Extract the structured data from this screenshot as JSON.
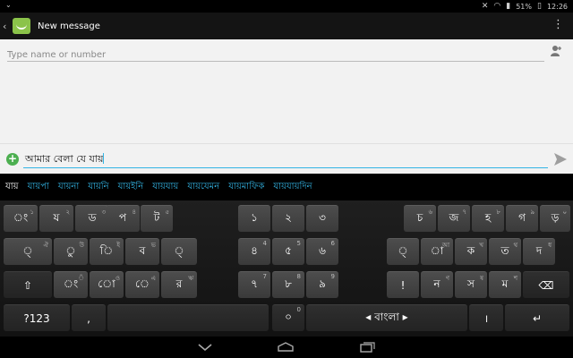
{
  "status": {
    "battery": "51%",
    "time": "12:26"
  },
  "action_bar": {
    "title": "New message"
  },
  "recipient": {
    "placeholder": "Type name or number"
  },
  "message": {
    "text": "আমার বেলা যে যায়"
  },
  "suggestions": [
    "যায়",
    "যায়পা",
    "যায়না",
    "যায়নি",
    "যায়ইনি",
    "যায়যায়",
    "যায়যেমন",
    "যায়মাফিক",
    "যায়যায়দিন"
  ],
  "keyboard": {
    "row1_left": [
      {
        "main": "ং",
        "hint": "১"
      },
      {
        "main": "য",
        "hint": "২"
      },
      {
        "main": "ড",
        "hint": "৩"
      },
      {
        "main": "প",
        "hint": "৪"
      },
      {
        "main": "ট",
        "hint": "৫"
      }
    ],
    "row1_mid": [
      "১",
      "২",
      "৩"
    ],
    "row1_right": [
      {
        "main": "চ",
        "hint": "৬"
      },
      {
        "main": "জ",
        "hint": "৭"
      },
      {
        "main": "হ",
        "hint": "৮"
      },
      {
        "main": "গ",
        "hint": "৯"
      },
      {
        "main": "ড়",
        "hint": "০"
      }
    ],
    "row2_left": [
      {
        "main": "্",
        "hint": "ঐ"
      },
      {
        "main": "ু",
        "hint": "উ"
      },
      {
        "main": "ি",
        "hint": "ই"
      },
      {
        "main": "ব",
        "hint": "ভ"
      },
      {
        "main": "্",
        "hint": ""
      }
    ],
    "row2_mid": [
      {
        "main": "৪",
        "hint": "4"
      },
      {
        "main": "৫",
        "hint": "5"
      },
      {
        "main": "৬",
        "hint": "6"
      }
    ],
    "row2_right": [
      {
        "main": "্",
        "hint": ""
      },
      {
        "main": "া",
        "hint": "আ"
      },
      {
        "main": "ক",
        "hint": "খ"
      },
      {
        "main": "ত",
        "hint": "থ"
      },
      {
        "main": "দ",
        "hint": "ধ"
      }
    ],
    "shift": "⇧",
    "row3_left": [
      {
        "main": "ং",
        "hint": "ঁ"
      },
      {
        "main": "ো",
        "hint": "ও"
      },
      {
        "main": "ে",
        "hint": "এ"
      },
      {
        "main": "র",
        "hint": "ঋ"
      }
    ],
    "row3_mid": [
      {
        "main": "৭",
        "hint": "7"
      },
      {
        "main": "৮",
        "hint": "8"
      },
      {
        "main": "৯",
        "hint": "9"
      }
    ],
    "row3_right": [
      {
        "main": "!",
        "hint": ""
      },
      {
        "main": "ন",
        "hint": "ণ"
      },
      {
        "main": "স",
        "hint": "ষ"
      },
      {
        "main": "ম",
        "hint": "শ"
      }
    ],
    "backspace": "⌫",
    "symbols": "?123",
    "comma": ",",
    "zero": {
      "main": "০",
      "hint": "0"
    },
    "space_label": "◂ বাংলা ▸",
    "danda": "।",
    "enter": "↵"
  }
}
